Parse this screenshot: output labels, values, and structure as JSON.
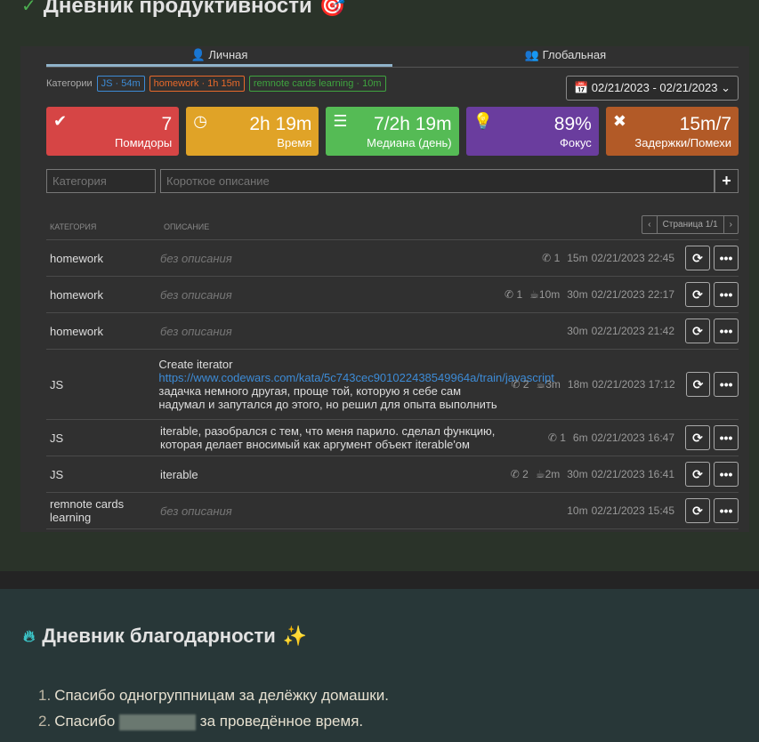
{
  "title": "Дневник продуктивности",
  "title_emoji": "🎯",
  "tabs": [
    "Личная",
    "Глобальная"
  ],
  "categories_label": "Категории",
  "chips": [
    {
      "label": "JS · 54m",
      "color": "#3d8bd6"
    },
    {
      "label": "homework · 1h 15m",
      "color": "#e8692a"
    },
    {
      "label": "remnote cards learning · 10m",
      "color": "#3fa43f"
    }
  ],
  "date_range": "02/21/2023 - 02/21/2023",
  "cards": [
    {
      "value": "7",
      "label": "Помидоры",
      "color": "#d64545",
      "icon": "✔"
    },
    {
      "value": "2h 19m",
      "label": "Время",
      "color": "#e0a327",
      "icon": "◷"
    },
    {
      "value": "7/2h 19m",
      "label": "Медиана (день)",
      "color": "#55bb55",
      "icon": "☰"
    },
    {
      "value": "89%",
      "label": "Фокус",
      "color": "#6a3d9e",
      "icon": "💡"
    },
    {
      "value": "15m/7",
      "label": "Задержки/Помехи",
      "color": "#b25a27",
      "icon": "✖"
    }
  ],
  "inputs": {
    "category_placeholder": "Категория",
    "desc_placeholder": "Короткое описание",
    "add": "+"
  },
  "table": {
    "col_category": "КАТЕГОРИЯ",
    "col_desc": "ОПИСАНИЕ",
    "page": "Страница 1/1",
    "prev": "‹",
    "next": "›",
    "rows": [
      {
        "cat": "homework",
        "desc": "без описания",
        "empty": true,
        "calls": "1",
        "brk": "",
        "dur": "15m",
        "time": "02/21/2023 22:45"
      },
      {
        "cat": "homework",
        "desc": "без описания",
        "empty": true,
        "calls": "1",
        "brk": "10m",
        "dur": "30m",
        "time": "02/21/2023 22:17"
      },
      {
        "cat": "homework",
        "desc": "без описания",
        "empty": true,
        "calls": "",
        "brk": "",
        "dur": "30m",
        "time": "02/21/2023 21:42"
      },
      {
        "cat": "JS",
        "desc_pre": "Create iterator",
        "link": "https://www.codewars.com/kata/5c743cec901022438549964a/train/javascript",
        "desc": " задачка немного другая, проще той, которую я себе сам надумал и запутался до этого, но решил для опыта выполнить",
        "empty": false,
        "calls": "2",
        "brk": "3m",
        "dur": "18m",
        "time": "02/21/2023 17:12"
      },
      {
        "cat": "JS",
        "desc": "iterable, разобрался с тем, что меня парило. сделал функцию, которая делает вносимый как аргумент объект iterable'ом",
        "empty": false,
        "calls": "1",
        "brk": "",
        "dur": "6m",
        "time": "02/21/2023 16:47"
      },
      {
        "cat": "JS",
        "desc": "iterable",
        "empty": false,
        "calls": "2",
        "brk": "2m",
        "dur": "30m",
        "time": "02/21/2023 16:41"
      },
      {
        "cat": "remnote cards learning",
        "desc": "без описания",
        "empty": true,
        "calls": "",
        "brk": "",
        "dur": "10m",
        "time": "02/21/2023 15:45"
      }
    ]
  },
  "gratitude": {
    "title": "Дневник благодарности",
    "emoji": "✨",
    "items": [
      {
        "n": "1.",
        "text": "Спасибо одногруппницам за делёжку домашки."
      },
      {
        "n": "2.",
        "pre": "Спасибо",
        "post": "за проведённое время."
      }
    ]
  }
}
